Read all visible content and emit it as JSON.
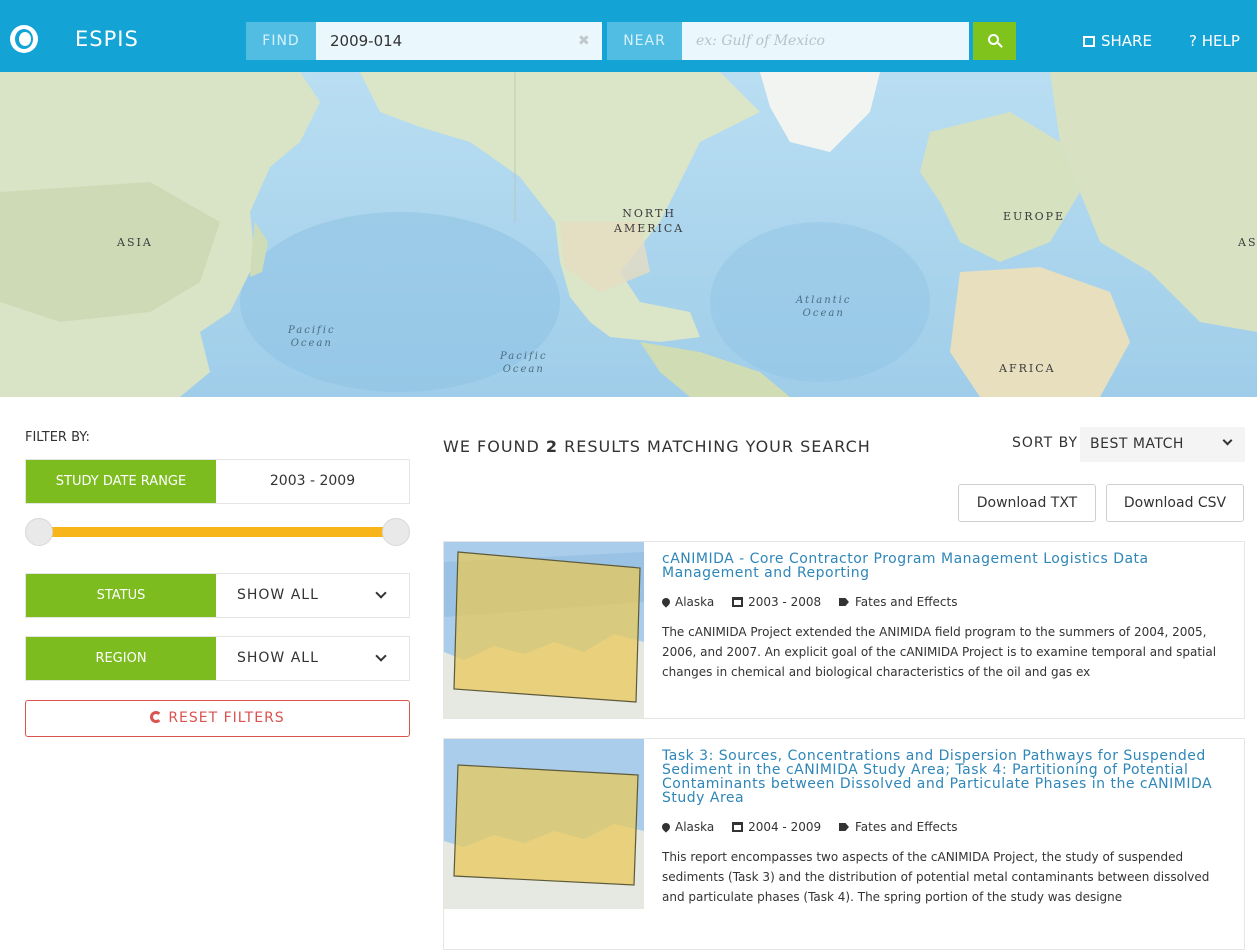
{
  "header": {
    "brand": "ESPIS",
    "find_label": "FIND",
    "find_value": "2009-014",
    "clear_glyph": "✖",
    "near_label": "NEAR",
    "near_placeholder": "ex: Gulf of Mexico",
    "share_label": "SHARE",
    "help_label": "? HELP",
    "colors": {
      "bar": "#13a3d4",
      "search_button": "#7fc31c"
    }
  },
  "map": {
    "labels": {
      "north_america_1": "NORTH",
      "north_america_2": "AMERICA",
      "asia_left": "ASIA",
      "europe": "EUROPE",
      "asia_right": "AS",
      "africa": "AFRICA",
      "pacific_1_a": "Pacific",
      "pacific_1_b": "Ocean",
      "pacific_2_a": "Pacific",
      "pacific_2_b": "Ocean",
      "atlantic_a": "Atlantic",
      "atlantic_b": "Ocean"
    }
  },
  "filters": {
    "title": "FILTER BY:",
    "date_range": {
      "label": "STUDY DATE RANGE",
      "value": "2003 - 2009",
      "slider_low_fraction": 0.0,
      "slider_high_fraction": 1.0
    },
    "status": {
      "label": "STATUS",
      "value": "SHOW ALL"
    },
    "region": {
      "label": "REGION",
      "value": "SHOW ALL"
    },
    "reset_label": "RESET FILTERS",
    "colors": {
      "tag": "#7cbc1f",
      "slider": "#f7b51a",
      "reset": "#d9534f"
    }
  },
  "results": {
    "heading_prefix": "WE FOUND",
    "count": "2",
    "heading_suffix": "RESULTS MATCHING YOUR SEARCH",
    "sort_label": "SORT BY",
    "sort_value": "BEST MATCH",
    "download_txt": "Download TXT",
    "download_csv": "Download CSV",
    "items": [
      {
        "title": "cANIMIDA - Core Contractor Program Management Logistics Data Management and Reporting",
        "location": "Alaska",
        "dates": "2003 - 2008",
        "topic": "Fates and Effects",
        "description": "The cANIMIDA Project extended the ANIMIDA field program to the summers of 2004, 2005, 2006, and 2007. An explicit goal of the cANIMIDA Project is to examine temporal and spatial changes in chemical and biological characteristics of the oil and gas ex"
      },
      {
        "title": "Task 3: Sources, Concentrations and Dispersion Pathways for Suspended Sediment in the cANIMIDA Study Area; Task 4: Partitioning of Potential Contaminants between Dissolved and Particulate Phases in the cANIMIDA Study Area",
        "location": "Alaska",
        "dates": "2004 - 2009",
        "topic": "Fates and Effects",
        "description": "This report encompasses two aspects of the cANIMIDA Project, the study of suspended sediments (Task 3) and the distribution of potential metal contaminants between dissolved and particulate phases (Task 4). The spring portion of the study was designe"
      }
    ],
    "colors": {
      "title": "#2f86b8"
    }
  }
}
